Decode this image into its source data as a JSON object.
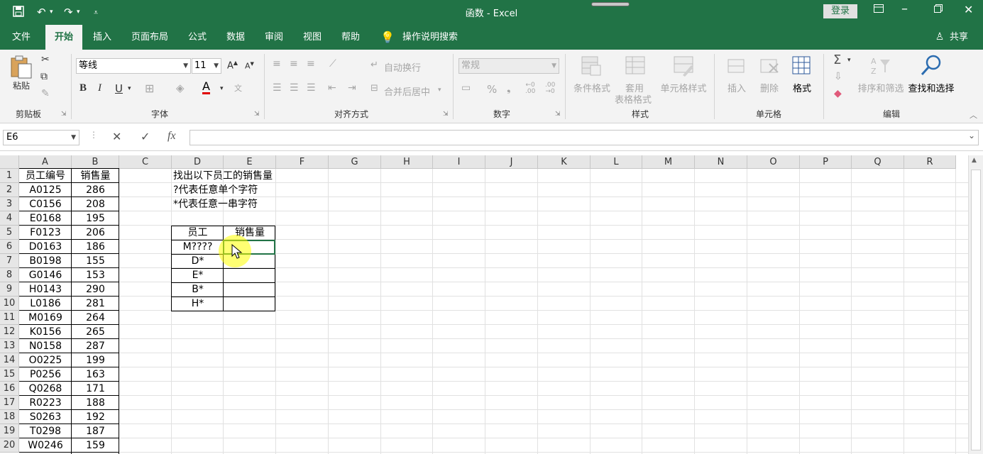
{
  "window": {
    "title": "函数 - Excel",
    "login_label": "登录"
  },
  "tabs": [
    "文件",
    "开始",
    "插入",
    "页面布局",
    "公式",
    "数据",
    "审阅",
    "视图",
    "帮助"
  ],
  "active_tab": "开始",
  "tell_me": "操作说明搜索",
  "share": "共享",
  "ribbon": {
    "clipboard": {
      "paste": "粘贴",
      "label": "剪贴板"
    },
    "font": {
      "name": "等线",
      "size": "11",
      "bold": "B",
      "italic": "I",
      "underline": "U",
      "color_letter": "A",
      "label": "字体"
    },
    "alignment": {
      "wrap": "自动换行",
      "merge": "合并后居中",
      "label": "对齐方式"
    },
    "number": {
      "format": "常规",
      "percent": "%",
      "label": "数字"
    },
    "styles": {
      "conditional": "条件格式",
      "table_format_1": "套用",
      "table_format_2": "表格格式",
      "cell_styles": "单元格样式",
      "label": "样式"
    },
    "cells": {
      "insert": "插入",
      "delete": "删除",
      "format": "格式",
      "label": "单元格"
    },
    "editing": {
      "sort_filter": "排序和筛选",
      "find_select": "查找和选择",
      "label": "编辑"
    }
  },
  "formula_bar": {
    "name_box": "E6",
    "fx": "fx",
    "formula": ""
  },
  "columns": [
    "A",
    "B",
    "C",
    "D",
    "E",
    "F",
    "G",
    "H",
    "I",
    "J",
    "K",
    "L",
    "M",
    "N",
    "O",
    "P",
    "Q",
    "R"
  ],
  "rows": [
    "1",
    "2",
    "3",
    "4",
    "5",
    "6",
    "7",
    "8",
    "9",
    "10",
    "11",
    "12",
    "13",
    "14",
    "15",
    "16",
    "17",
    "18",
    "19",
    "20"
  ],
  "table_main": {
    "header": [
      "员工编号",
      "销售量"
    ],
    "rows": [
      [
        "A0125",
        "286"
      ],
      [
        "C0156",
        "208"
      ],
      [
        "E0168",
        "195"
      ],
      [
        "F0123",
        "206"
      ],
      [
        "D0163",
        "186"
      ],
      [
        "B0198",
        "155"
      ],
      [
        "G0146",
        "153"
      ],
      [
        "H0143",
        "290"
      ],
      [
        "L0186",
        "281"
      ],
      [
        "M0169",
        "264"
      ],
      [
        "K0156",
        "265"
      ],
      [
        "N0158",
        "287"
      ],
      [
        "O0225",
        "199"
      ],
      [
        "P0256",
        "163"
      ],
      [
        "Q0268",
        "171"
      ],
      [
        "R0223",
        "188"
      ],
      [
        "S0263",
        "192"
      ],
      [
        "T0298",
        "187"
      ],
      [
        "W0246",
        "159"
      ]
    ]
  },
  "notes": [
    "找出以下员工的销售量",
    "?代表任意单个字符",
    "*代表任意一串字符"
  ],
  "lookup_table": {
    "header": [
      "员工",
      "销售量"
    ],
    "rows": [
      "M????",
      "D*",
      "E*",
      "B*",
      "H*"
    ]
  },
  "colors": {
    "excel_green": "#217346",
    "highlight": "#ffff00"
  }
}
